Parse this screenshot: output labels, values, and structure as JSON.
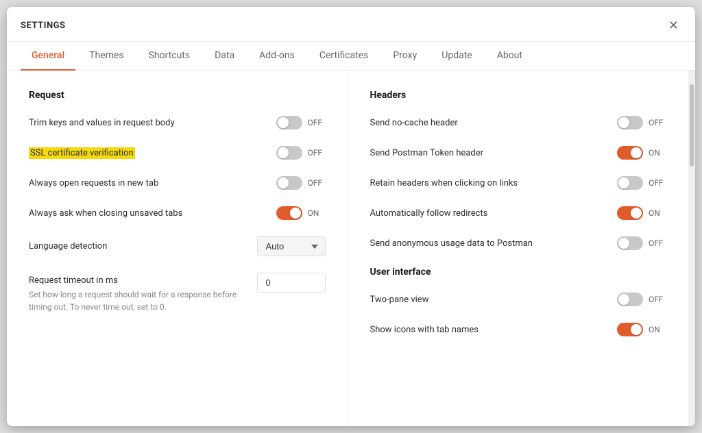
{
  "window": {
    "title": "SETTINGS",
    "close_label": "✕"
  },
  "tabs": [
    {
      "id": "general",
      "label": "General",
      "active": true
    },
    {
      "id": "themes",
      "label": "Themes",
      "active": false
    },
    {
      "id": "shortcuts",
      "label": "Shortcuts",
      "active": false
    },
    {
      "id": "data",
      "label": "Data",
      "active": false
    },
    {
      "id": "addons",
      "label": "Add-ons",
      "active": false
    },
    {
      "id": "certificates",
      "label": "Certificates",
      "active": false
    },
    {
      "id": "proxy",
      "label": "Proxy",
      "active": false
    },
    {
      "id": "update",
      "label": "Update",
      "active": false
    },
    {
      "id": "about",
      "label": "About",
      "active": false
    }
  ],
  "left_section": {
    "title": "Request",
    "settings": [
      {
        "id": "trim-keys",
        "label": "Trim keys and values in request body",
        "highlighted": false,
        "toggle_state": "off",
        "toggle_text": "OFF",
        "type": "toggle"
      },
      {
        "id": "ssl-verification",
        "label": "SSL certificate verification",
        "highlighted": true,
        "toggle_state": "off",
        "toggle_text": "OFF",
        "type": "toggle"
      },
      {
        "id": "open-new-tab",
        "label": "Always open requests in new tab",
        "highlighted": false,
        "toggle_state": "off",
        "toggle_text": "OFF",
        "type": "toggle"
      },
      {
        "id": "ask-closing",
        "label": "Always ask when closing unsaved tabs",
        "highlighted": false,
        "toggle_state": "on",
        "toggle_text": "ON",
        "type": "toggle"
      },
      {
        "id": "language-detection",
        "label": "Language detection",
        "highlighted": false,
        "type": "dropdown",
        "dropdown_value": "Auto"
      },
      {
        "id": "request-timeout",
        "label": "Request timeout in ms",
        "highlighted": false,
        "sub_label": "Set how long a request should wait for a response before timing out. To never time out, set to 0.",
        "type": "number",
        "number_value": "0"
      }
    ]
  },
  "right_section": {
    "headers_title": "Headers",
    "headers_settings": [
      {
        "id": "no-cache",
        "label": "Send no-cache header",
        "toggle_state": "off",
        "toggle_text": "OFF"
      },
      {
        "id": "postman-token",
        "label": "Send Postman Token header",
        "toggle_state": "on",
        "toggle_text": "ON"
      },
      {
        "id": "retain-headers",
        "label": "Retain headers when clicking on links",
        "toggle_state": "off",
        "toggle_text": "OFF"
      },
      {
        "id": "follow-redirects",
        "label": "Automatically follow redirects",
        "toggle_state": "on",
        "toggle_text": "ON"
      },
      {
        "id": "usage-data",
        "label": "Send anonymous usage data to Postman",
        "toggle_state": "off",
        "toggle_text": "OFF"
      }
    ],
    "ui_title": "User interface",
    "ui_settings": [
      {
        "id": "two-pane",
        "label": "Two-pane view",
        "toggle_state": "off",
        "toggle_text": "OFF"
      },
      {
        "id": "show-icons",
        "label": "Show icons with tab names",
        "toggle_state": "on",
        "toggle_text": "ON"
      }
    ]
  }
}
